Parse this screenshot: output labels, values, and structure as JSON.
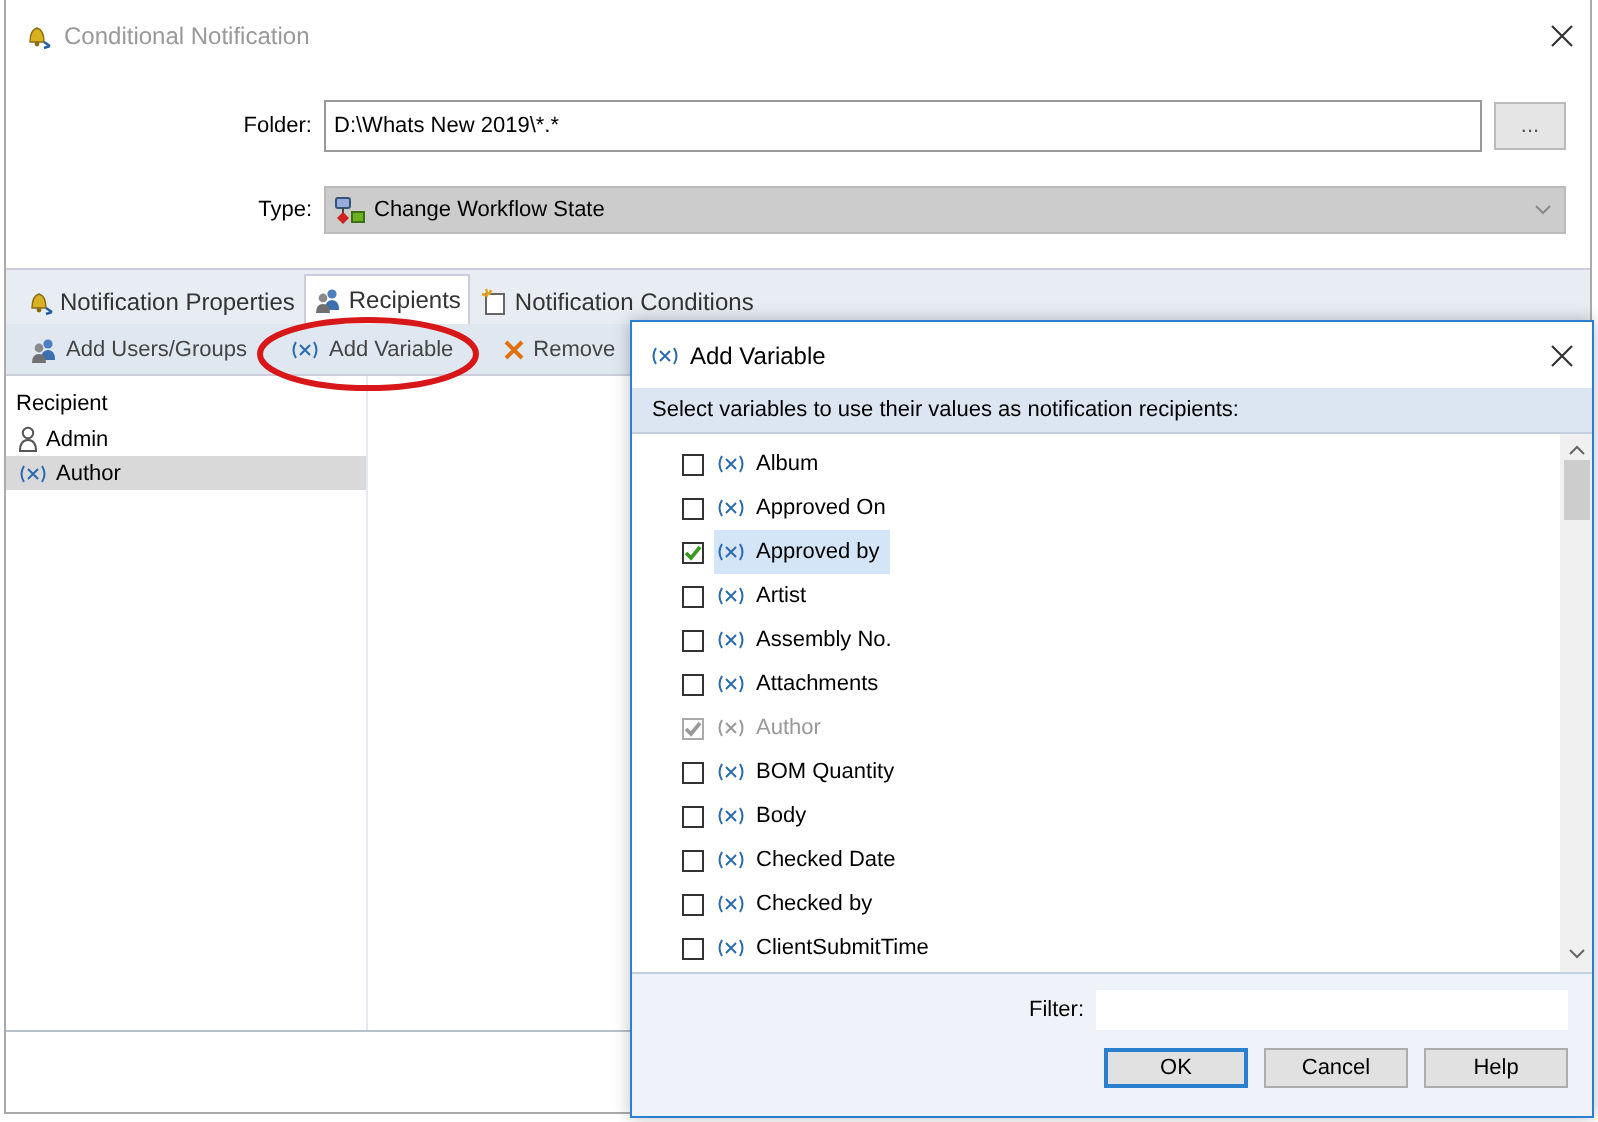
{
  "window": {
    "title": "Conditional Notification"
  },
  "form": {
    "folder_label": "Folder:",
    "folder_value": "D:\\Whats New 2019\\*.*",
    "browse_button": "...",
    "type_label": "Type:",
    "type_value": "Change Workflow State"
  },
  "tabs": [
    {
      "label": "Notification Properties",
      "selected": false,
      "kind": "bell"
    },
    {
      "label": "Recipients",
      "selected": true,
      "kind": "users"
    },
    {
      "label": "Notification Conditions",
      "selected": false,
      "kind": "doc"
    }
  ],
  "toolbar": [
    {
      "label": "Add Users/Groups",
      "kind": "users"
    },
    {
      "label": "Add Variable",
      "kind": "variable"
    },
    {
      "label": "Remove",
      "kind": "remove"
    }
  ],
  "recipients": {
    "header": "Recipient",
    "items": [
      {
        "label": "Admin",
        "kind": "user",
        "selected": false
      },
      {
        "label": "Author",
        "kind": "variable",
        "selected": true
      }
    ]
  },
  "dialog": {
    "title": "Add Variable",
    "instruction": "Select variables to use their values as notification recipients:",
    "variables": [
      {
        "label": "Album",
        "checked": false,
        "disabled": false,
        "selected": false
      },
      {
        "label": "Approved On",
        "checked": false,
        "disabled": false,
        "selected": false
      },
      {
        "label": "Approved by",
        "checked": true,
        "disabled": false,
        "selected": true
      },
      {
        "label": "Artist",
        "checked": false,
        "disabled": false,
        "selected": false
      },
      {
        "label": "Assembly No.",
        "checked": false,
        "disabled": false,
        "selected": false
      },
      {
        "label": "Attachments",
        "checked": false,
        "disabled": false,
        "selected": false
      },
      {
        "label": "Author",
        "checked": true,
        "disabled": true,
        "selected": false
      },
      {
        "label": "BOM Quantity",
        "checked": false,
        "disabled": false,
        "selected": false
      },
      {
        "label": "Body",
        "checked": false,
        "disabled": false,
        "selected": false
      },
      {
        "label": "Checked Date",
        "checked": false,
        "disabled": false,
        "selected": false
      },
      {
        "label": "Checked by",
        "checked": false,
        "disabled": false,
        "selected": false
      },
      {
        "label": "ClientSubmitTime",
        "checked": false,
        "disabled": false,
        "selected": false
      }
    ],
    "filter_label": "Filter:",
    "buttons": [
      {
        "label": "OK",
        "default": true
      },
      {
        "label": "Cancel",
        "default": false
      },
      {
        "label": "Help",
        "default": false
      }
    ]
  }
}
